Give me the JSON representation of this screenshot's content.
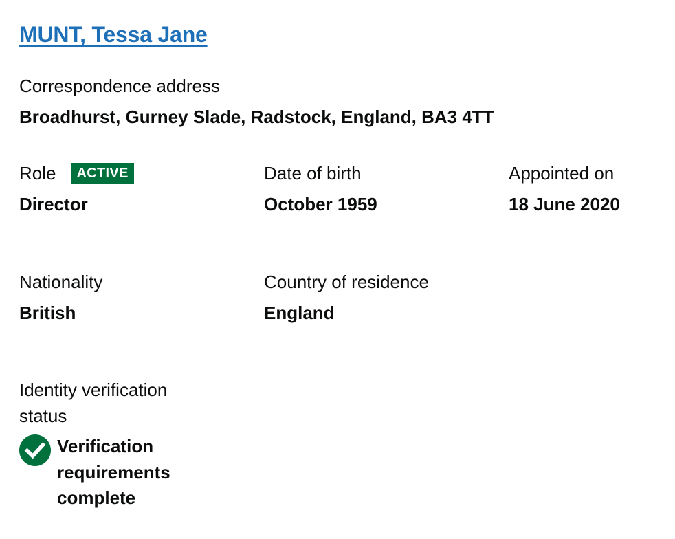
{
  "officer": {
    "name": "MUNT, Tessa Jane"
  },
  "address": {
    "label": "Correspondence address",
    "value": "Broadhurst, Gurney Slade, Radstock, England, BA3 4TT"
  },
  "role": {
    "label": "Role",
    "status_tag": "ACTIVE",
    "value": "Director"
  },
  "date_of_birth": {
    "label": "Date of birth",
    "value": "October 1959"
  },
  "appointed_on": {
    "label": "Appointed on",
    "value": "18 June 2020"
  },
  "nationality": {
    "label": "Nationality",
    "value": "British"
  },
  "country_of_residence": {
    "label": "Country of residence",
    "value": "England"
  },
  "identity_verification": {
    "label": "Identity verification status",
    "value": "Verification requirements complete",
    "icon": "check-circle-icon"
  },
  "colors": {
    "link": "#1d70b8",
    "tag_background": "#00703c",
    "text": "#0b0c0c"
  }
}
